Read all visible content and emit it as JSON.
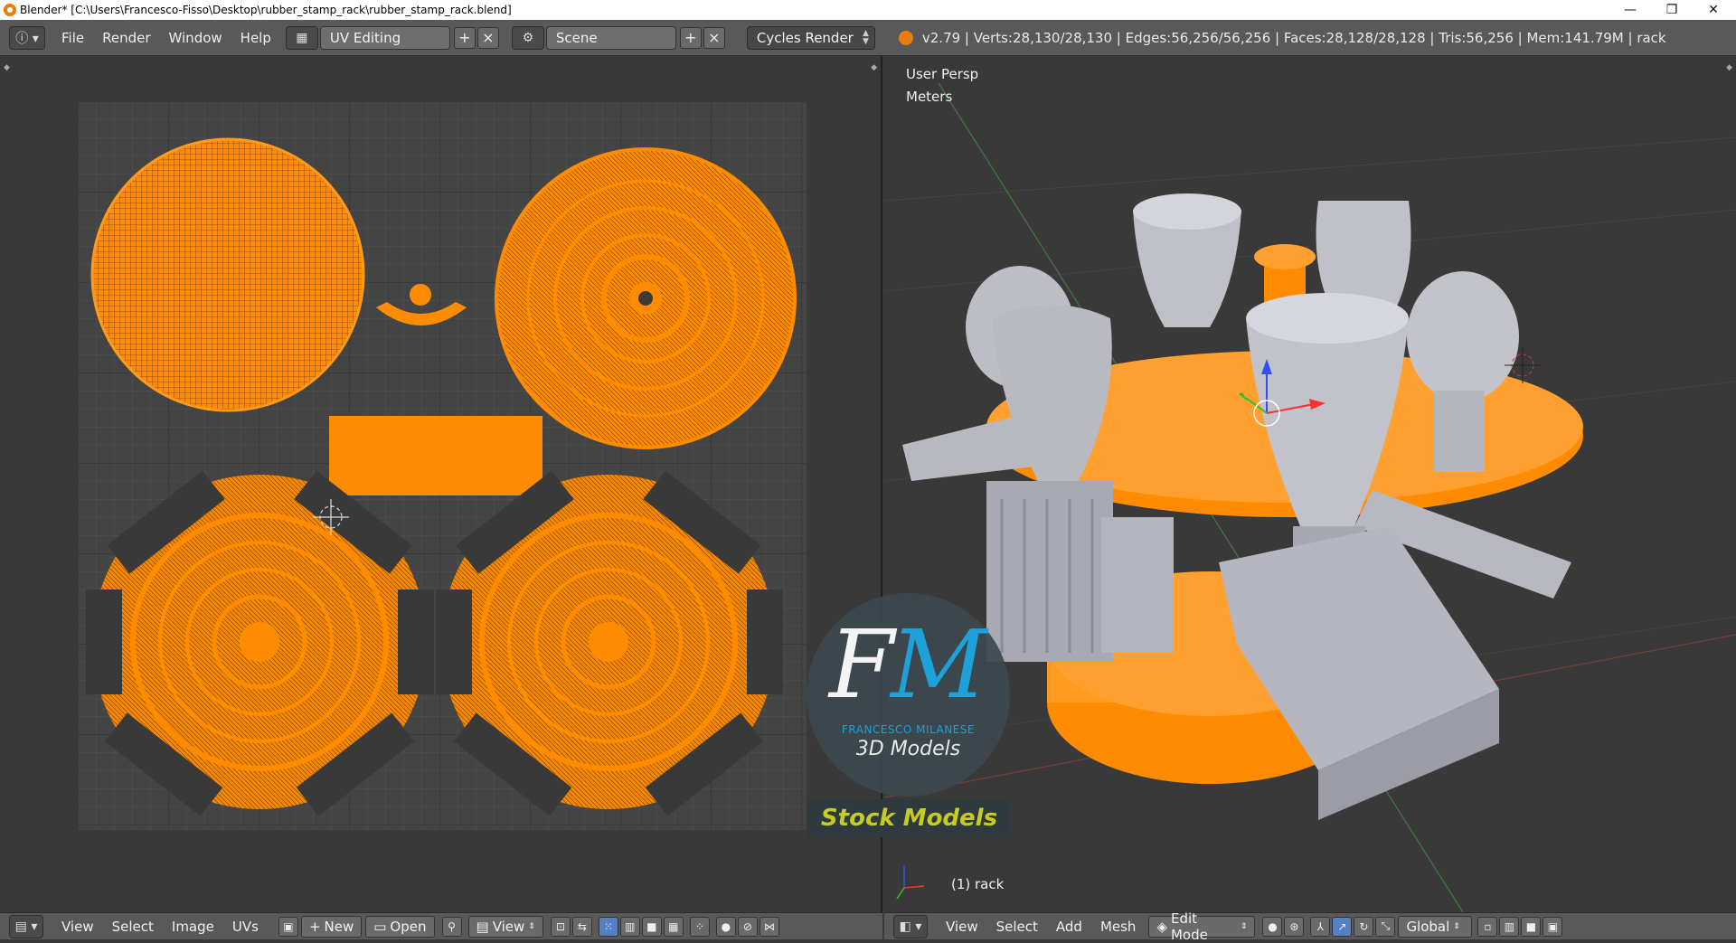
{
  "window": {
    "title": "Blender* [C:\\Users\\Francesco-Fisso\\Desktop\\rubber_stamp_rack\\rubber_stamp_rack.blend]",
    "minimize": "—",
    "maximize": "❐",
    "close": "✕"
  },
  "info_header": {
    "menus": [
      "File",
      "Render",
      "Window",
      "Help"
    ],
    "screen_layout": "UV Editing",
    "scene": "Scene",
    "render_engine": "Cycles Render",
    "stats": "v2.79 | Verts:28,130/28,130 | Edges:56,256/56,256 | Faces:28,128/28,128 | Tris:56,256 | Mem:141.79M | rack"
  },
  "viewport": {
    "view_name": "User Persp",
    "units": "Meters",
    "object_label": "(1) rack"
  },
  "uv_header": {
    "menus": [
      "View",
      "Select",
      "Image",
      "UVs"
    ],
    "new_label": "New",
    "open_label": "Open",
    "view_label": "View"
  },
  "view3d_header": {
    "menus": [
      "View",
      "Select",
      "Add",
      "Mesh"
    ],
    "mode": "Edit Mode",
    "orientation": "Global"
  },
  "watermark": {
    "letter_f": "F",
    "letter_m": "M",
    "name": "FRANCESCO MILANESE",
    "subtitle": "3D Models",
    "banner": "Stock Models"
  },
  "colors": {
    "uv_orange": "#ff8c00",
    "header_gray": "#595959",
    "editor_bg": "#393939",
    "brand_blue": "#1da1d8",
    "brand_yellow": "#c5cc22"
  }
}
